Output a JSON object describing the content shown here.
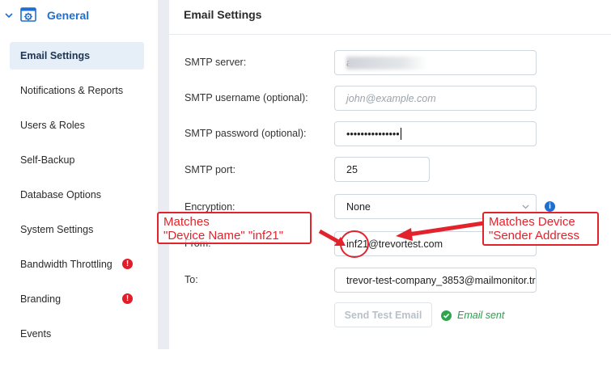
{
  "sidebar": {
    "group_title": "General",
    "items": [
      {
        "label": "Email Settings",
        "active": true,
        "alert": false
      },
      {
        "label": "Notifications & Reports",
        "active": false,
        "alert": false
      },
      {
        "label": "Users & Roles",
        "active": false,
        "alert": false
      },
      {
        "label": "Self-Backup",
        "active": false,
        "alert": false
      },
      {
        "label": "Database Options",
        "active": false,
        "alert": false
      },
      {
        "label": "System Settings",
        "active": false,
        "alert": false
      },
      {
        "label": "Bandwidth Throttling",
        "active": false,
        "alert": true
      },
      {
        "label": "Branding",
        "active": false,
        "alert": true
      },
      {
        "label": "Events",
        "active": false,
        "alert": false
      }
    ],
    "alert_glyph": "!"
  },
  "main": {
    "title": "Email Settings",
    "fields": {
      "smtp_server": {
        "label": "SMTP server:",
        "value": "a"
      },
      "smtp_username": {
        "label": "SMTP username (optional):",
        "placeholder": "john@example.com"
      },
      "smtp_password": {
        "label": "SMTP password (optional):",
        "value": "•••••••••••••••"
      },
      "smtp_port": {
        "label": "SMTP port:",
        "value": "25"
      },
      "encryption": {
        "label": "Encryption:",
        "value": "None"
      },
      "from": {
        "label": "From:",
        "value": "inf21@trevortest.com"
      },
      "to": {
        "label": "To:",
        "value": "trevor-test-company_3853@mailmonitor.tr"
      }
    },
    "info_glyph": "i",
    "send_button": "Send Test Email",
    "status": "Email sent"
  },
  "annotations": {
    "left": {
      "line1": "Matches",
      "line2": "\"Device Name\" \"inf21\""
    },
    "right": {
      "line1": "Matches Device",
      "line2": "\"Sender Address"
    },
    "color": "#e3232c"
  },
  "colors": {
    "accent": "#1f6fd1",
    "active_bg": "#e6eef8",
    "alert": "#e11d2a",
    "success": "#2ea44f"
  },
  "icons": {
    "group_chevron": "chevron-down-icon",
    "group_icon": "settings-gear-icon",
    "encryption_caret": "chevron-down-icon",
    "info": "info-icon",
    "success": "check-circle-icon"
  }
}
